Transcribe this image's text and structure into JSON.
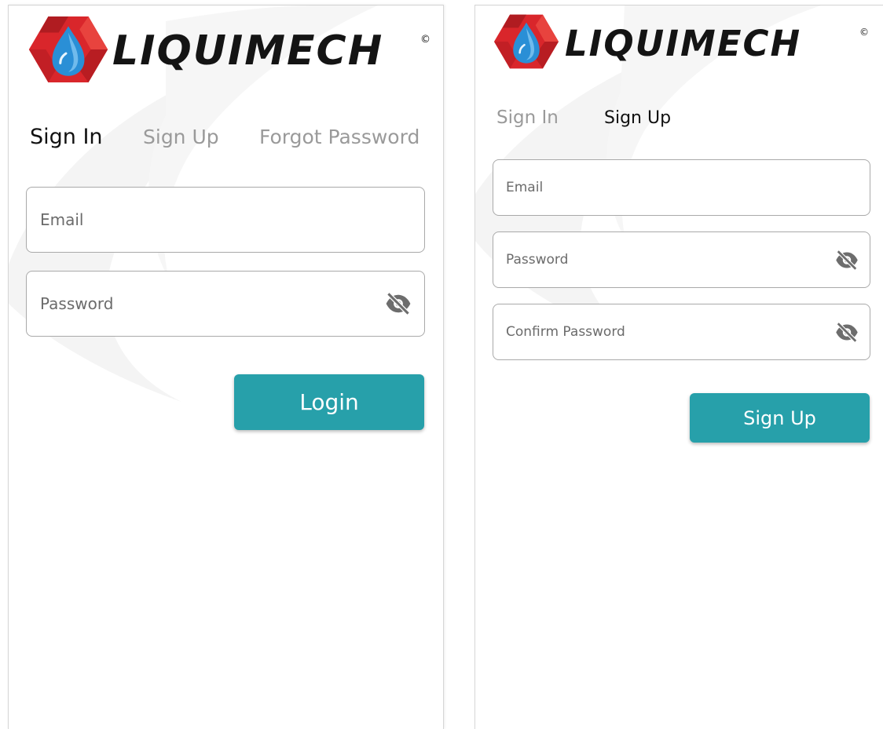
{
  "brand": {
    "name": "LIQUIMECH",
    "copyright_mark": "©",
    "colors": {
      "red": "#d9262b",
      "drop_blue": "#2a8fd6",
      "wordmark": "#141414"
    },
    "icon": "hexagon-drop-logo"
  },
  "accent_color": "#27a0aa",
  "sign_in_screen": {
    "tabs": [
      {
        "label": "Sign In",
        "active": true
      },
      {
        "label": "Sign Up",
        "active": false
      },
      {
        "label": "Forgot Password",
        "active": false
      }
    ],
    "email_placeholder": "Email",
    "password_placeholder": "Password",
    "password_toggle_icon": "eye-off-icon",
    "submit_label": "Login"
  },
  "sign_up_screen": {
    "tabs": [
      {
        "label": "Sign In",
        "active": false
      },
      {
        "label": "Sign Up",
        "active": true
      }
    ],
    "email_placeholder": "Email",
    "password_placeholder": "Password",
    "confirm_password_placeholder": "Confirm Password",
    "password_toggle_icon": "eye-off-icon",
    "submit_label": "Sign Up"
  }
}
